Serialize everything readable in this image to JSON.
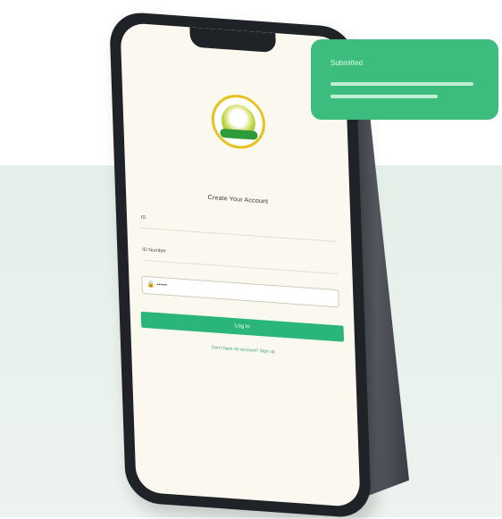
{
  "toast": {
    "title": "Submitted"
  },
  "form": {
    "title": "Create Your Account",
    "field_1_label": "ID",
    "field_2_label": "ID Number",
    "password_value": "••••••",
    "login_button": "Log In",
    "footer_link": "Don't have an account? Sign up"
  },
  "colors": {
    "accent": "#2ab57a",
    "toast": "#3dbd7d",
    "screen": "#fbf9ef"
  }
}
